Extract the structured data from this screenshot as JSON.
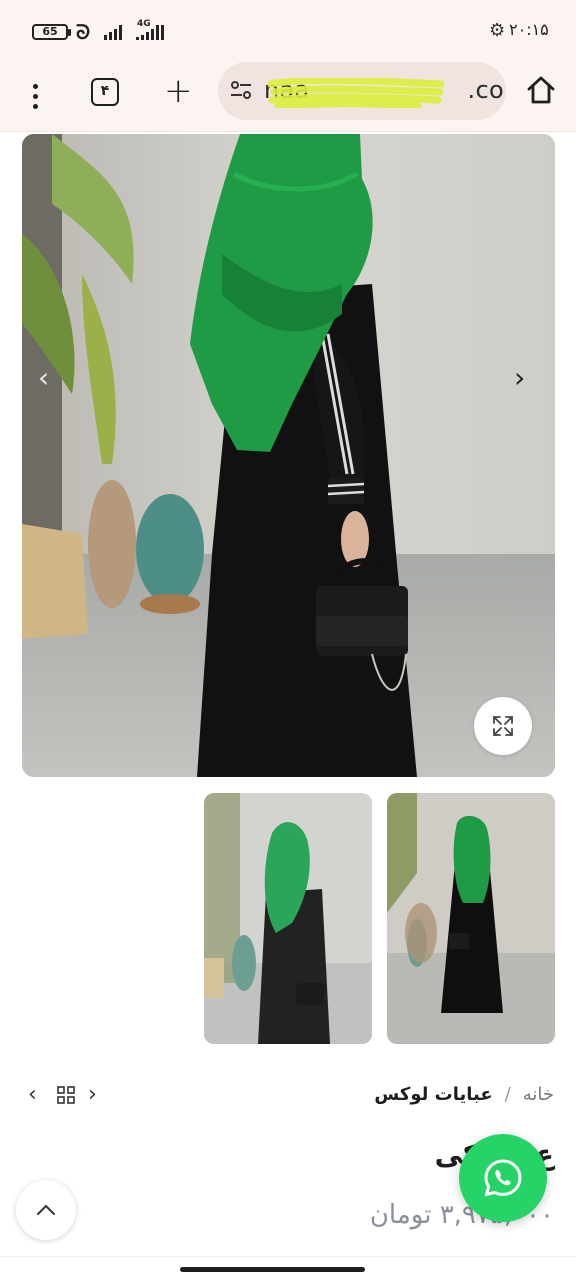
{
  "status_bar": {
    "battery": "65",
    "network": "4G",
    "time": "۲۰:۱۵",
    "icons": [
      "sync-icon",
      "signal-icon",
      "gear-icon"
    ]
  },
  "browser": {
    "tab_count": "۴",
    "url_visible_start": "naa",
    "url_visible_end": ".com",
    "icons": [
      "more-vert-icon",
      "tabs-icon",
      "plus-icon",
      "tune-icon",
      "home-icon"
    ]
  },
  "gallery": {
    "prev_glyph": "‹",
    "next_glyph": "›",
    "thumbnail_count": 2,
    "icons": [
      "chevron-left-icon",
      "chevron-right-icon",
      "expand-icon"
    ]
  },
  "breadcrumb": {
    "home": "خانه",
    "separator": "/",
    "category": "عبایات لوکس",
    "prev_glyph": "‹",
    "next_glyph": "›"
  },
  "product": {
    "title": "ع     مشکی",
    "price": "۳,۹۷۵,۰۰۰ تومان"
  },
  "floating": {
    "icons": [
      "chevron-up-icon",
      "whatsapp-icon"
    ]
  },
  "colors": {
    "toolbar_bg": "#fcf4f1",
    "address_bar_bg": "#f1e3df",
    "whatsapp_green": "#25d366",
    "scarf_green": "#1f9a45",
    "scribble_highlight": "#d8ee3a",
    "price_gray": "#8a8f9c"
  }
}
